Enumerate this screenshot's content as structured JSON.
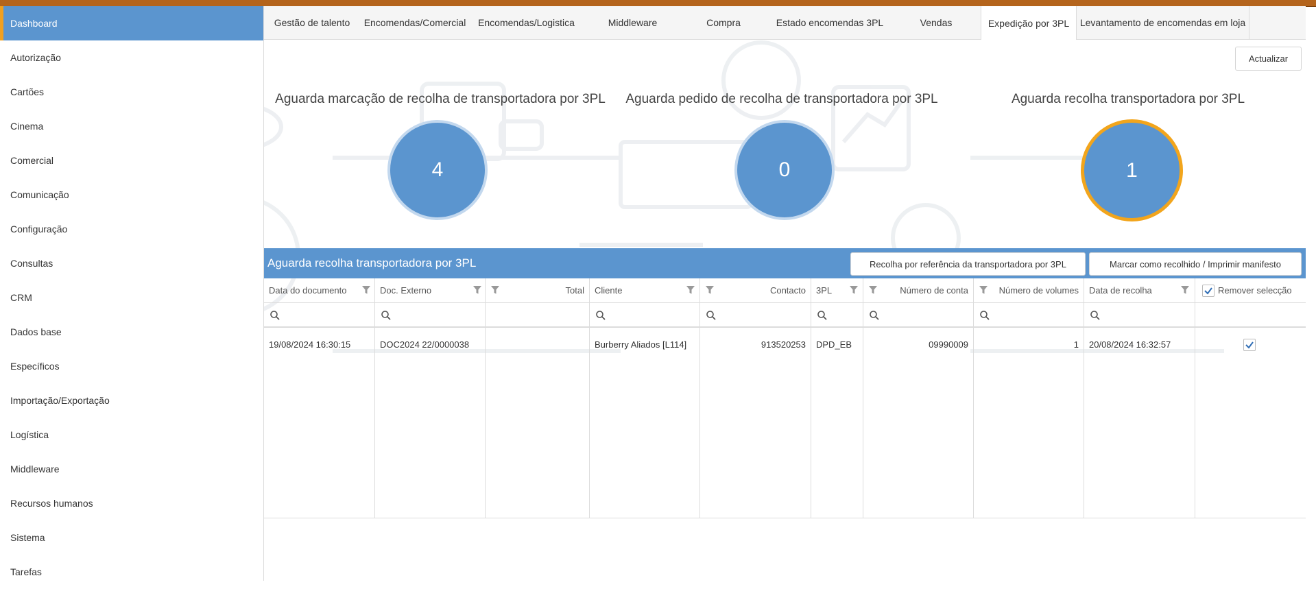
{
  "sidebar": {
    "items": [
      {
        "label": "Dashboard"
      },
      {
        "label": "Autorização"
      },
      {
        "label": "Cartões"
      },
      {
        "label": "Cinema"
      },
      {
        "label": "Comercial"
      },
      {
        "label": "Comunicação"
      },
      {
        "label": "Configuração"
      },
      {
        "label": "Consultas"
      },
      {
        "label": "CRM"
      },
      {
        "label": "Dados base"
      },
      {
        "label": "Específicos"
      },
      {
        "label": "Importação/Exportação"
      },
      {
        "label": "Logística"
      },
      {
        "label": "Middleware"
      },
      {
        "label": "Recursos humanos"
      },
      {
        "label": "Sistema"
      },
      {
        "label": "Tarefas"
      }
    ]
  },
  "tabs": [
    {
      "label": "Gestão de talento"
    },
    {
      "label": "Encomendas/Comercial"
    },
    {
      "label": "Encomendas/Logistica"
    },
    {
      "label": "Middleware"
    },
    {
      "label": "Compra"
    },
    {
      "label": "Estado encomendas 3PL"
    },
    {
      "label": "Vendas"
    },
    {
      "label": "Expedição por 3PL"
    },
    {
      "label": "Levantamento de encomendas em loja"
    }
  ],
  "toolbar": {
    "refresh_label": "Actualizar"
  },
  "stats": [
    {
      "title": "Aguarda marcação de recolha de transportadora por 3PL",
      "value": "4"
    },
    {
      "title": "Aguarda pedido de recolha de transportadora por 3PL",
      "value": "0"
    },
    {
      "title": "Aguarda recolha transportadora por 3PL",
      "value": "1"
    }
  ],
  "grid": {
    "title": "Aguarda recolha transportadora por 3PL",
    "buttons": {
      "pickup_by_reference": "Recolha por referência da transportadora por 3PL",
      "mark_collected": "Marcar como recolhido / Imprimir manifesto"
    },
    "columns": [
      "Data do documento",
      "Doc. Externo",
      "Total",
      "Cliente",
      "Contacto",
      "3PL",
      "Número de conta",
      "Número de volumes",
      "Data de recolha",
      "Remover selecção"
    ],
    "rows": [
      {
        "date": "19/08/2024 16:30:15",
        "ext_doc": "DOC2024 22/0000038",
        "total": "",
        "client": "Burberry Aliados [L114]",
        "contact": "913520253",
        "tpl": "DPD_EB",
        "account": "09990009",
        "volumes": "1",
        "pickup_date": "20/08/2024 16:32:57",
        "selected": true
      }
    ]
  },
  "colors": {
    "accent": "#5b95cf",
    "highlight": "#f2a51c",
    "topbar": "#b4641c"
  }
}
